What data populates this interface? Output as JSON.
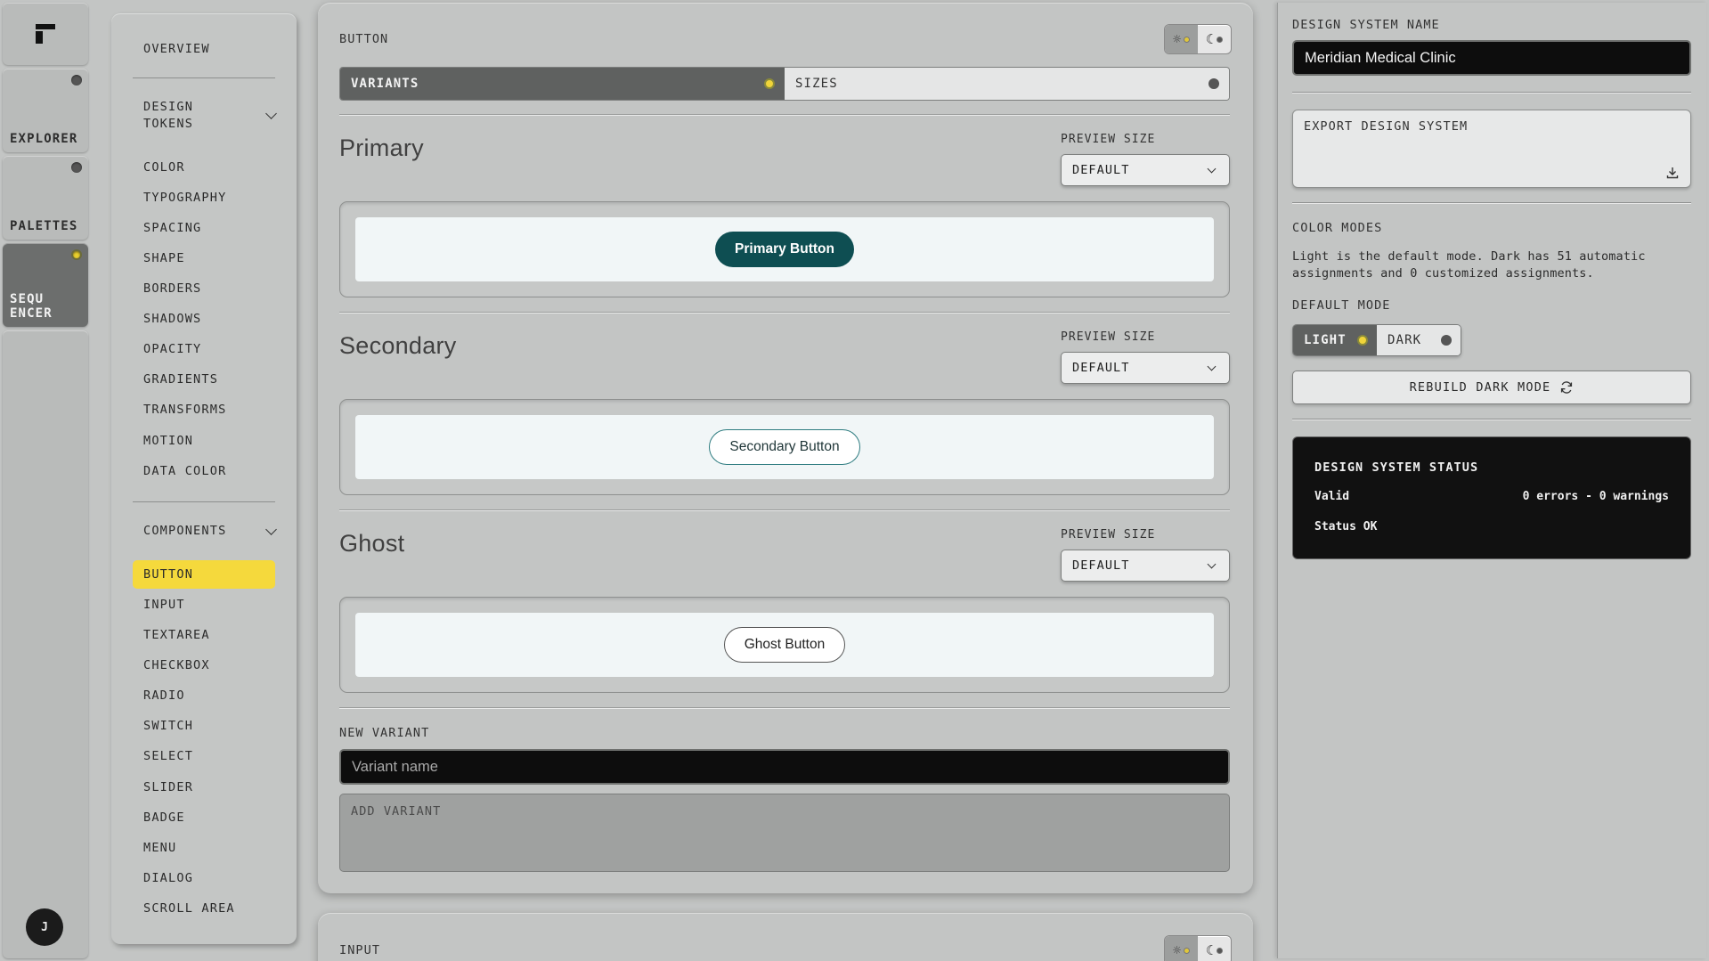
{
  "rail": {
    "items": [
      {
        "label": "EXPLORER"
      },
      {
        "label": "PALETTES"
      },
      {
        "label": "SEQU\nENCER",
        "line1": "SEQU",
        "line2": "ENCER"
      }
    ],
    "avatar": "J"
  },
  "nav": {
    "overview": "OVERVIEW",
    "design_tokens": {
      "label_line1": "DESIGN",
      "label_line2": "TOKENS",
      "items": [
        "COLOR",
        "TYPOGRAPHY",
        "SPACING",
        "SHAPE",
        "BORDERS",
        "SHADOWS",
        "OPACITY",
        "GRADIENTS",
        "TRANSFORMS",
        "MOTION",
        "DATA COLOR"
      ]
    },
    "components": {
      "label": "COMPONENTS",
      "items": [
        "BUTTON",
        "INPUT",
        "TEXTAREA",
        "CHECKBOX",
        "RADIO",
        "SWITCH",
        "SELECT",
        "SLIDER",
        "BADGE",
        "MENU",
        "DIALOG",
        "SCROLL AREA"
      ],
      "active": "BUTTON"
    }
  },
  "main": {
    "section_title": "BUTTON",
    "tabs": [
      {
        "label": "VARIANTS",
        "active": true
      },
      {
        "label": "SIZES",
        "active": false
      }
    ],
    "variants": [
      {
        "title": "Primary",
        "preview_label": "PREVIEW SIZE",
        "size": "DEFAULT",
        "button": "Primary Button"
      },
      {
        "title": "Secondary",
        "preview_label": "PREVIEW SIZE",
        "size": "DEFAULT",
        "button": "Secondary Button"
      },
      {
        "title": "Ghost",
        "preview_label": "PREVIEW SIZE",
        "size": "DEFAULT",
        "button": "Ghost Button"
      }
    ],
    "new_variant": {
      "label": "NEW VARIANT",
      "placeholder": "Variant name",
      "add_label": "ADD VARIANT"
    },
    "next_section_title": "INPUT"
  },
  "right": {
    "name_label": "DESIGN SYSTEM NAME",
    "name_value": "Meridian Medical Clinic",
    "export_label": "EXPORT DESIGN SYSTEM",
    "color_modes_label": "COLOR MODES",
    "color_modes_desc": "Light is the default mode. Dark has 51 automatic assignments and 0 customized assignments.",
    "default_mode_label": "DEFAULT MODE",
    "modes": [
      {
        "label": "LIGHT",
        "active": true
      },
      {
        "label": "DARK",
        "active": false
      }
    ],
    "rebuild_label": "REBUILD DARK MODE",
    "status": {
      "title": "DESIGN SYSTEM STATUS",
      "valid_label": "Valid",
      "valid_value": "0 errors - 0 warnings",
      "ok_label": "Status OK"
    }
  },
  "colors": {
    "accent": "#f5d93c",
    "primary_button": "#0e4e52",
    "secondary_border": "#2e7c80",
    "status_bg": "#111111"
  }
}
